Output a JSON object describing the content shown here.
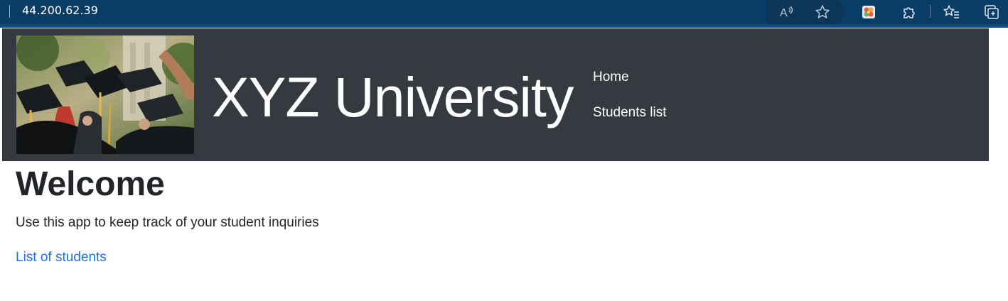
{
  "browser": {
    "address": "44.200.62.39",
    "icons": [
      "read-aloud-icon",
      "favorite-star-icon",
      "extension-flower-icon",
      "extensions-puzzle-icon",
      "favorites-list-icon",
      "collections-icon"
    ]
  },
  "header": {
    "title": "XYZ University",
    "hero_image": "graduation-caps-photo",
    "nav": [
      {
        "label": "Home"
      },
      {
        "label": "Students list"
      }
    ]
  },
  "main": {
    "heading": "Welcome",
    "lead": "Use this app to keep track of your student inquiries",
    "link_label": "List of students"
  },
  "colors": {
    "header_bg": "#343a40",
    "link": "#1a73e8",
    "browser_bar": "#0a3d66"
  }
}
